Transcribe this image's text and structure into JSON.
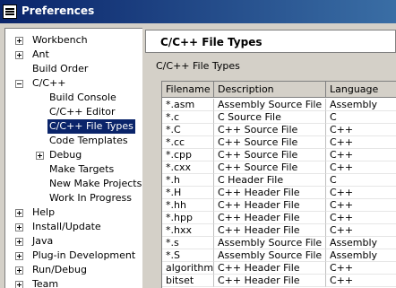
{
  "window": {
    "title": "Preferences"
  },
  "tree": {
    "items": [
      {
        "label": "Workbench"
      },
      {
        "label": "Ant"
      },
      {
        "label": "Build Order"
      },
      {
        "label": "C/C++"
      },
      {
        "label": "Build Console"
      },
      {
        "label": "C/C++ Editor"
      },
      {
        "label": "C/C++ File Types"
      },
      {
        "label": "Code Templates"
      },
      {
        "label": "Debug"
      },
      {
        "label": "Make Targets"
      },
      {
        "label": "New Make Projects"
      },
      {
        "label": "Work In Progress"
      },
      {
        "label": "Help"
      },
      {
        "label": "Install/Update"
      },
      {
        "label": "Java"
      },
      {
        "label": "Plug-in Development"
      },
      {
        "label": "Run/Debug"
      },
      {
        "label": "Team"
      }
    ]
  },
  "page": {
    "title": "C/C++ File Types",
    "section_label": "C/C++ File Types"
  },
  "table": {
    "headers": [
      "Filename",
      "Description",
      "Language"
    ],
    "rows": [
      [
        "*.asm",
        "Assembly Source File",
        "Assembly"
      ],
      [
        "*.c",
        "C Source File",
        "C"
      ],
      [
        "*.C",
        "C++ Source File",
        "C++"
      ],
      [
        "*.cc",
        "C++ Source File",
        "C++"
      ],
      [
        "*.cpp",
        "C++ Source File",
        "C++"
      ],
      [
        "*.cxx",
        "C++ Source File",
        "C++"
      ],
      [
        "*.h",
        "C Header File",
        "C"
      ],
      [
        "*.H",
        "C++ Header File",
        "C++"
      ],
      [
        "*.hh",
        "C++ Header File",
        "C++"
      ],
      [
        "*.hpp",
        "C++ Header File",
        "C++"
      ],
      [
        "*.hxx",
        "C++ Header File",
        "C++"
      ],
      [
        "*.s",
        "Assembly Source File",
        "Assembly"
      ],
      [
        "*.S",
        "Assembly Source File",
        "Assembly"
      ],
      [
        "algorithm",
        "C++ Header File",
        "C++"
      ],
      [
        "bitset",
        "C++ Header File",
        "C++"
      ]
    ]
  }
}
